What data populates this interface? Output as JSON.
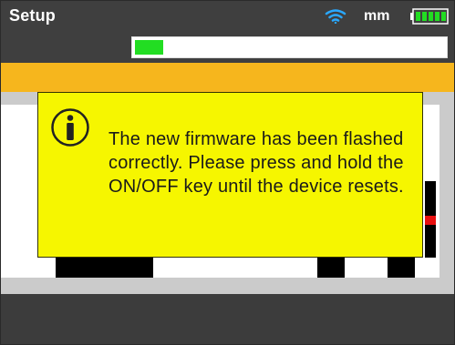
{
  "header": {
    "title": "Setup",
    "unit": "mm",
    "wifi_icon": "wifi-icon",
    "battery_icon": "battery-full-icon"
  },
  "progress": {
    "fraction": 0.09,
    "color": "#22dd22"
  },
  "dialog": {
    "icon": "info-icon",
    "message": "The new firmware has been flashed correctly. Please press and hold the ON/OFF key until the device resets."
  },
  "colors": {
    "accent": "#f6b61d",
    "dialog_bg": "#f6f600",
    "background_dark": "#3c3c3c"
  }
}
